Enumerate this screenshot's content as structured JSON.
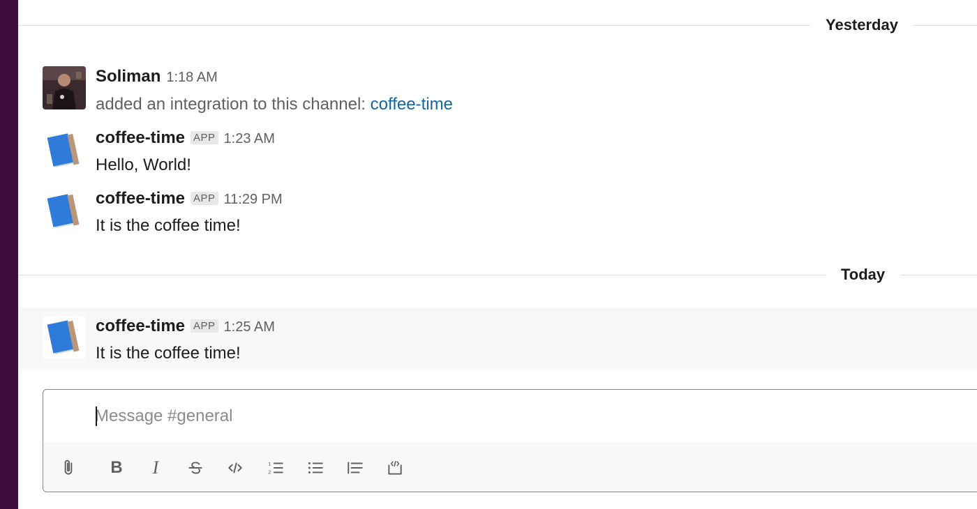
{
  "dividers": {
    "yesterday": "Yesterday",
    "today": "Today"
  },
  "messages": [
    {
      "sender": "Soliman",
      "time": "1:18 AM",
      "text": "added an integration to this channel: ",
      "link_text": "coffee-time",
      "avatar": "user-photo"
    },
    {
      "sender": "coffee-time",
      "badge": "APP",
      "time": "1:23 AM",
      "text": "Hello, World!",
      "avatar": "notebook-icon"
    },
    {
      "sender": "coffee-time",
      "badge": "APP",
      "time": "11:29 PM",
      "text": "It is the coffee time!",
      "avatar": "notebook-icon"
    },
    {
      "sender": "coffee-time",
      "badge": "APP",
      "time": "1:25 AM",
      "text": "It is the coffee time!",
      "avatar": "notebook-icon"
    }
  ],
  "composer": {
    "placeholder": "Message #general",
    "tools": [
      "paperclip-icon",
      "bold-icon",
      "italic-icon",
      "strikethrough-icon",
      "code-icon",
      "numbered-list-icon",
      "bulleted-list-icon",
      "blockquote-icon",
      "code-block-icon"
    ]
  },
  "colors": {
    "sidebar": "#3f0e40",
    "link": "#1264a3",
    "highlight": "#f8f8f8"
  }
}
